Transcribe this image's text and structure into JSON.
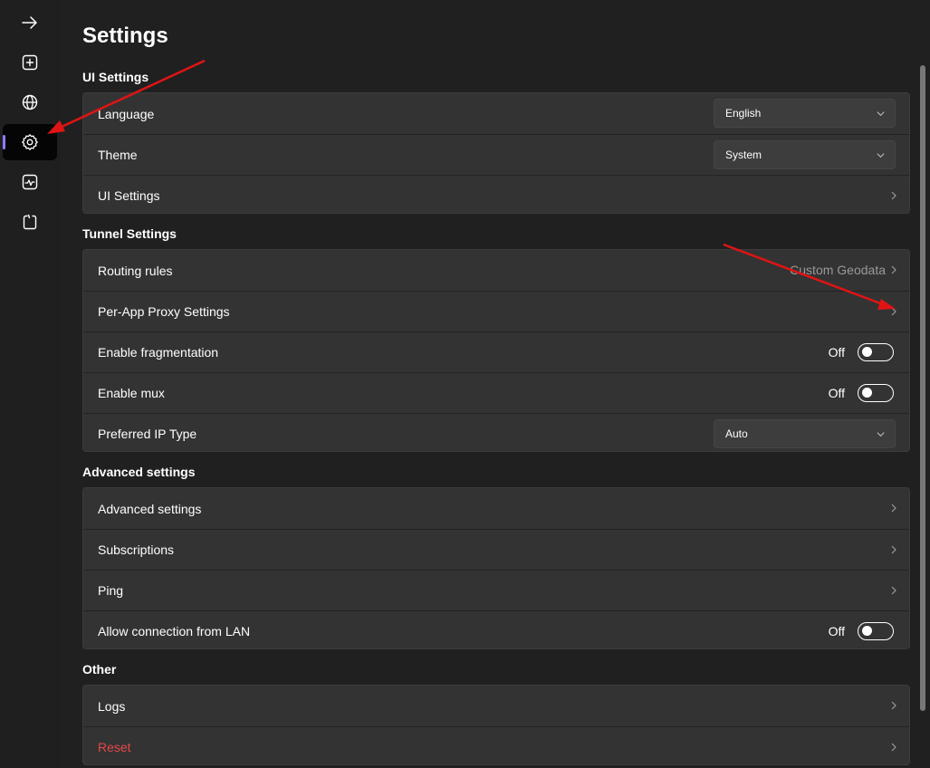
{
  "sidebar": {
    "items": [
      {
        "icon": "arrow-right-icon",
        "active": false
      },
      {
        "icon": "add-square-icon",
        "active": false
      },
      {
        "icon": "globe-icon",
        "active": false
      },
      {
        "icon": "gear-icon",
        "active": true
      },
      {
        "icon": "activity-monitor-icon",
        "active": false
      },
      {
        "icon": "clipboard-icon",
        "active": false
      }
    ]
  },
  "page": {
    "title": "Settings"
  },
  "sections": {
    "ui": {
      "title": "UI Settings",
      "language_label": "Language",
      "language_value": "English",
      "theme_label": "Theme",
      "theme_value": "System",
      "ui_settings_label": "UI Settings"
    },
    "tunnel": {
      "title": "Tunnel Settings",
      "routing_label": "Routing rules",
      "routing_value": "Custom Geodata",
      "per_app_label": "Per-App Proxy Settings",
      "fragmentation_label": "Enable fragmentation",
      "fragmentation_state": "Off",
      "mux_label": "Enable mux",
      "mux_state": "Off",
      "ip_type_label": "Preferred IP Type",
      "ip_type_value": "Auto"
    },
    "advanced": {
      "title": "Advanced settings",
      "advanced_label": "Advanced settings",
      "subscriptions_label": "Subscriptions",
      "ping_label": "Ping",
      "lan_label": "Allow connection from LAN",
      "lan_state": "Off"
    },
    "other": {
      "title": "Other",
      "logs_label": "Logs",
      "reset_label": "Reset"
    }
  },
  "colors": {
    "accent": "#8a7dff",
    "danger": "#e54848",
    "annotation_arrow": "#e01414"
  }
}
